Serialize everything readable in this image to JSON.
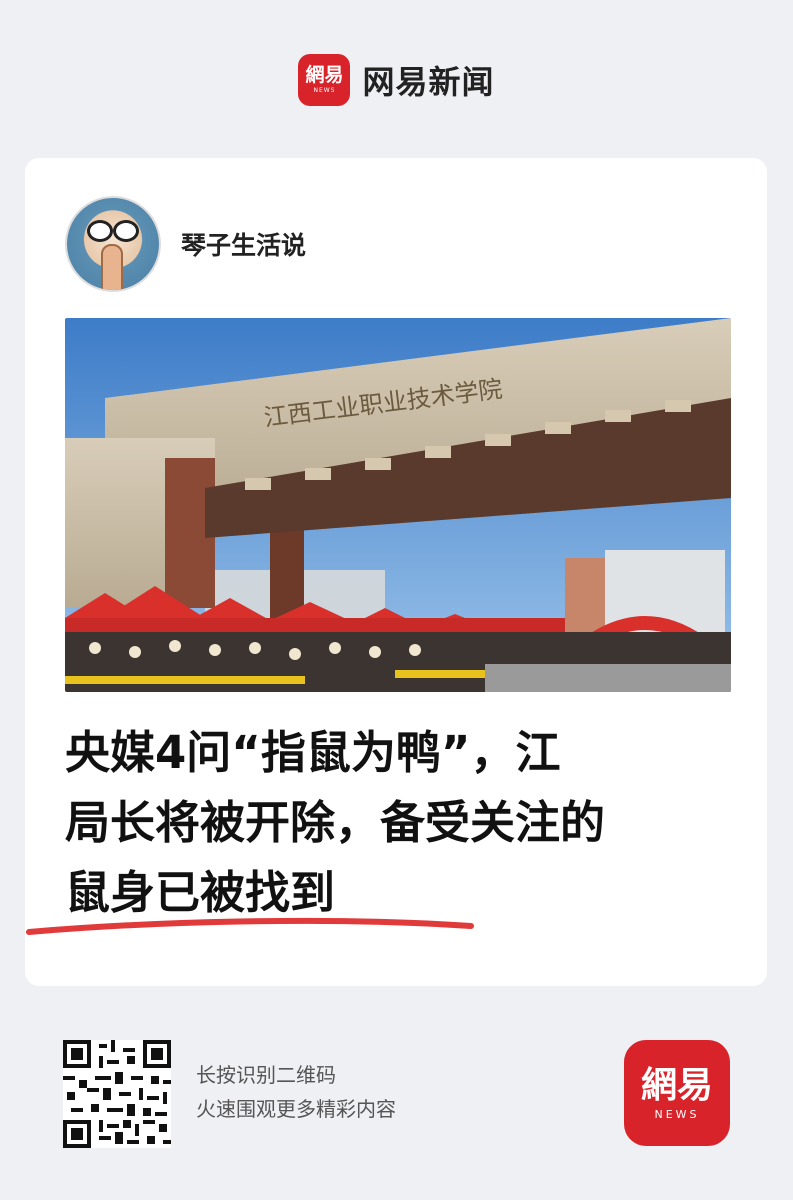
{
  "header": {
    "logo": {
      "cn": "網易",
      "en": "NEWS"
    },
    "app_name": "网易新闻"
  },
  "post": {
    "author": "琴子生活说",
    "photo": {
      "gate_inscription": "江西工业职业技术学院"
    },
    "headline_lines": [
      "央媒4问“指鼠为鸭”，江",
      "局长将被开除，备受关注的",
      "鼠身已被找到"
    ]
  },
  "footer": {
    "qr_hint_1": "长按识别二维码",
    "qr_hint_2": "火速围观更多精彩内容",
    "logo": {
      "cn": "網易",
      "en": "NEWS"
    }
  },
  "colors": {
    "brand_red": "#d8232a",
    "underline_red": "#e03a3a",
    "background": "#eef0f4"
  }
}
